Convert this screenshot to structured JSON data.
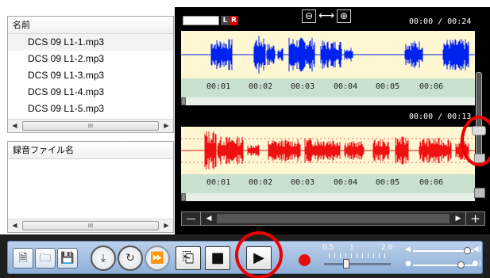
{
  "file_list": {
    "header": "名前",
    "items": [
      "DCS 09 L1-1.mp3",
      "DCS 09 L1-2.mp3",
      "DCS 09 L1-3.mp3",
      "DCS 09 L1-4.mp3",
      "DCS 09 L1-5.mp3"
    ],
    "scroll_thumb": "III"
  },
  "recording_list": {
    "header": "録音ファイル名",
    "scroll_thumb": "III"
  },
  "editor": {
    "top_track": {
      "time": "00:00 / 00:24",
      "ticks": [
        "00:01",
        "00:02",
        "00:03",
        "00:04",
        "00:05",
        "00:06"
      ],
      "wave_color": "#0022ee"
    },
    "bottom_track": {
      "time": "00:00 / 00:13",
      "ticks": [
        "00:01",
        "00:02",
        "00:03",
        "00:04",
        "00:05",
        "00:06"
      ],
      "wave_color": "#ee1111"
    },
    "lr_left": "L",
    "lr_right": "R",
    "zoom_out_icon": "⊖",
    "zoom_in_icon": "⊕"
  },
  "toolbar": {
    "speed_min": "0.5",
    "speed_mid": "1",
    "speed_max": "2.0",
    "speed_value": 1.0
  },
  "colors": {
    "accent_blue": "#8fb0d8",
    "record_red": "#e01010",
    "annotation_red": "#ee0000"
  }
}
